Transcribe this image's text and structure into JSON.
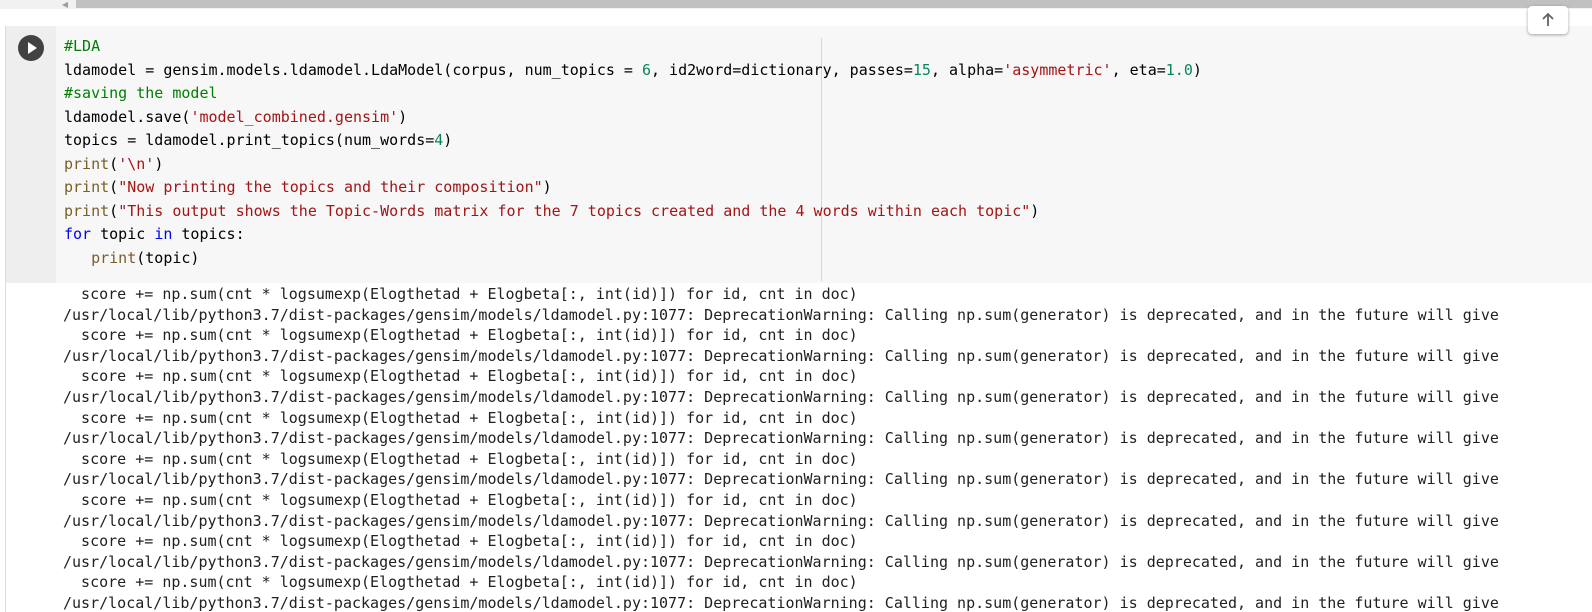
{
  "cell": {
    "code_lines": [
      [
        {
          "t": "#LDA",
          "c": "cm"
        }
      ],
      [
        {
          "t": "ldamodel = gensim.models.ldamodel.LdaModel(corpus, num_topics = ",
          "c": ""
        },
        {
          "t": "6",
          "c": "nu"
        },
        {
          "t": ", id2word=dictionary, passes=",
          "c": ""
        },
        {
          "t": "15",
          "c": "nu"
        },
        {
          "t": ", alpha=",
          "c": ""
        },
        {
          "t": "'asymmetric'",
          "c": "st"
        },
        {
          "t": ", eta=",
          "c": ""
        },
        {
          "t": "1.0",
          "c": "nu"
        },
        {
          "t": ")",
          "c": ""
        }
      ],
      [
        {
          "t": "#saving the model",
          "c": "cm"
        }
      ],
      [
        {
          "t": "ldamodel.save(",
          "c": ""
        },
        {
          "t": "'model_combined.gensim'",
          "c": "st"
        },
        {
          "t": ")",
          "c": ""
        }
      ],
      [
        {
          "t": "topics = ldamodel.print_topics(num_words=",
          "c": ""
        },
        {
          "t": "4",
          "c": "nu"
        },
        {
          "t": ")",
          "c": ""
        }
      ],
      [
        {
          "t": "print",
          "c": "bi"
        },
        {
          "t": "(",
          "c": ""
        },
        {
          "t": "'\\n'",
          "c": "st"
        },
        {
          "t": ")",
          "c": ""
        }
      ],
      [
        {
          "t": "print",
          "c": "bi"
        },
        {
          "t": "(",
          "c": ""
        },
        {
          "t": "\"Now printing the topics and their composition\"",
          "c": "st"
        },
        {
          "t": ")",
          "c": ""
        }
      ],
      [
        {
          "t": "print",
          "c": "bi"
        },
        {
          "t": "(",
          "c": ""
        },
        {
          "t": "\"This output shows the Topic-Words matrix for the 7 topics created and the 4 words within each topic\"",
          "c": "st"
        },
        {
          "t": ")",
          "c": ""
        }
      ],
      [
        {
          "t": "for",
          "c": "kw"
        },
        {
          "t": " topic ",
          "c": ""
        },
        {
          "t": "in",
          "c": "kw"
        },
        {
          "t": " topics:",
          "c": ""
        }
      ],
      [
        {
          "t": "   ",
          "c": ""
        },
        {
          "t": "print",
          "c": "bi"
        },
        {
          "t": "(topic)",
          "c": ""
        }
      ]
    ]
  },
  "output": {
    "lines": [
      "  score += np.sum(cnt * logsumexp(Elogthetad + Elogbeta[:, int(id)]) for id, cnt in doc)",
      "/usr/local/lib/python3.7/dist-packages/gensim/models/ldamodel.py:1077: DeprecationWarning: Calling np.sum(generator) is deprecated, and in the future will give",
      "  score += np.sum(cnt * logsumexp(Elogthetad + Elogbeta[:, int(id)]) for id, cnt in doc)",
      "/usr/local/lib/python3.7/dist-packages/gensim/models/ldamodel.py:1077: DeprecationWarning: Calling np.sum(generator) is deprecated, and in the future will give",
      "  score += np.sum(cnt * logsumexp(Elogthetad + Elogbeta[:, int(id)]) for id, cnt in doc)",
      "/usr/local/lib/python3.7/dist-packages/gensim/models/ldamodel.py:1077: DeprecationWarning: Calling np.sum(generator) is deprecated, and in the future will give",
      "  score += np.sum(cnt * logsumexp(Elogthetad + Elogbeta[:, int(id)]) for id, cnt in doc)",
      "/usr/local/lib/python3.7/dist-packages/gensim/models/ldamodel.py:1077: DeprecationWarning: Calling np.sum(generator) is deprecated, and in the future will give",
      "  score += np.sum(cnt * logsumexp(Elogthetad + Elogbeta[:, int(id)]) for id, cnt in doc)",
      "/usr/local/lib/python3.7/dist-packages/gensim/models/ldamodel.py:1077: DeprecationWarning: Calling np.sum(generator) is deprecated, and in the future will give",
      "  score += np.sum(cnt * logsumexp(Elogthetad + Elogbeta[:, int(id)]) for id, cnt in doc)",
      "/usr/local/lib/python3.7/dist-packages/gensim/models/ldamodel.py:1077: DeprecationWarning: Calling np.sum(generator) is deprecated, and in the future will give",
      "  score += np.sum(cnt * logsumexp(Elogthetad + Elogbeta[:, int(id)]) for id, cnt in doc)",
      "/usr/local/lib/python3.7/dist-packages/gensim/models/ldamodel.py:1077: DeprecationWarning: Calling np.sum(generator) is deprecated, and in the future will give",
      "  score += np.sum(cnt * logsumexp(Elogthetad + Elogbeta[:, int(id)]) for id, cnt in doc)",
      "/usr/local/lib/python3.7/dist-packages/gensim/models/ldamodel.py:1077: DeprecationWarning: Calling np.sum(generator) is deprecated, and in the future will give"
    ]
  },
  "toolbar": {
    "up_icon": "arrow-up-icon"
  },
  "icons": {
    "run": "play-icon",
    "scroll_left": "chevron-left-icon"
  },
  "colors": {
    "run_button": "#424242",
    "editor_bg": "#f7f7f7",
    "gutter_bg": "#eeeeee",
    "comment": "#008000",
    "string": "#a31515",
    "number": "#098658",
    "keyword": "#0000ff",
    "builtin": "#795e26"
  }
}
